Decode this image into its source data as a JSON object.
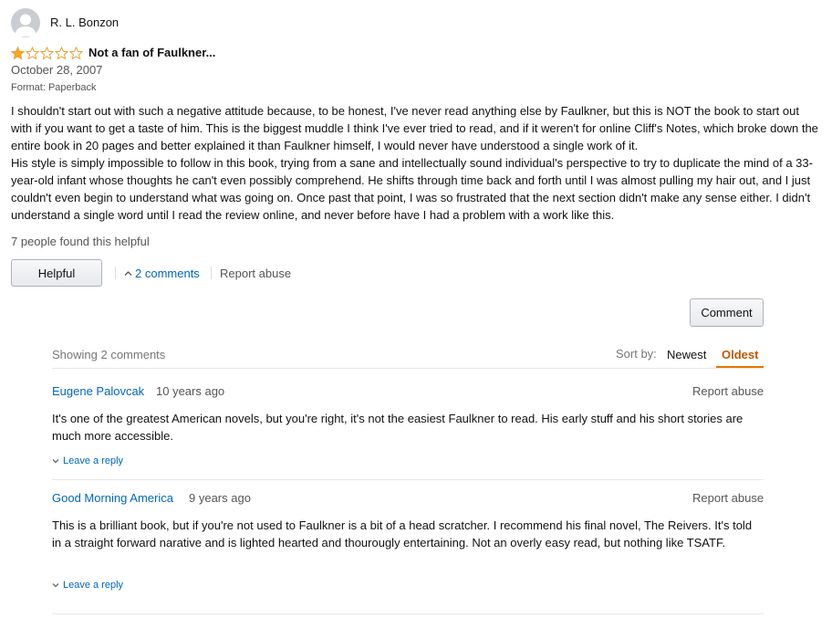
{
  "review": {
    "reviewer_name": "R. L. Bonzon",
    "rating": 1,
    "rating_max": 5,
    "title": "Not a fan of Faulkner...",
    "date": "October 28, 2007",
    "format": "Format: Paperback",
    "body_paragraphs": [
      "I shouldn't start out with such a negative attitude because, to be honest, I've never read anything else by Faulkner, but this is NOT the book to start out with if you want to get a taste of him. This is the biggest muddle I think I've ever tried to read, and if it weren't for online Cliff's Notes, which broke down the entire book in 20 pages and better explained it than Faulkner himself, I would never have understood a single work of it.",
      "His style is simply impossible to follow in this book, trying from a sane and intellectually sound individual's perspective to try to duplicate the mind of a 33-year-old infant whose thoughts he can't even possibly comprehend. He shifts through time back and forth until I was almost pulling my hair out, and I just couldn't even begin to understand what was going on. Once past that point, I was so frustrated that the next section didn't make any sense either. I didn't understand a single word until I read the review online, and never before have I had a problem with a work like this."
    ],
    "helpful_count_text": "7 people found this helpful",
    "helpful_button": "Helpful",
    "comments_link": "2 comments",
    "report_abuse": "Report abuse",
    "comment_button": "Comment"
  },
  "comments_section": {
    "showing_text": "Showing 2 comments",
    "sort_label": "Sort by:",
    "sort_options": [
      "Newest",
      "Oldest"
    ],
    "sort_selected": "Oldest",
    "comments": [
      {
        "author": "Eugene Palovcak",
        "age": "10 years ago",
        "report": "Report abuse",
        "text": "It's one of the greatest American novels, but you're right, it's not the easiest Faulkner to read. His early stuff and his short stories are much more accessible.",
        "reply": "Leave a reply"
      },
      {
        "author": "Good Morning America",
        "age": "9 years ago",
        "report": "Report abuse",
        "text": "This is a brilliant book, but if you're not used to Faulkner is a bit of a head scratcher. I recommend his final novel, The Reivers. It's told in a straight forward narative and is lighted hearted and thourougly entertaining. Not an overly easy read, but nothing like TSATF.",
        "reply": "Leave a reply"
      }
    ]
  },
  "colors": {
    "link": "#0066c0",
    "star": "#ffa41c",
    "sort_active": "#c45500",
    "sort_underline": "#e77600"
  },
  "icons": {
    "avatar": "default-user-avatar-icon",
    "star_filled": "star-filled-icon",
    "star_empty": "star-empty-icon",
    "comments_toggle": "chevron-up-icon",
    "reply_toggle": "chevron-down-icon"
  }
}
